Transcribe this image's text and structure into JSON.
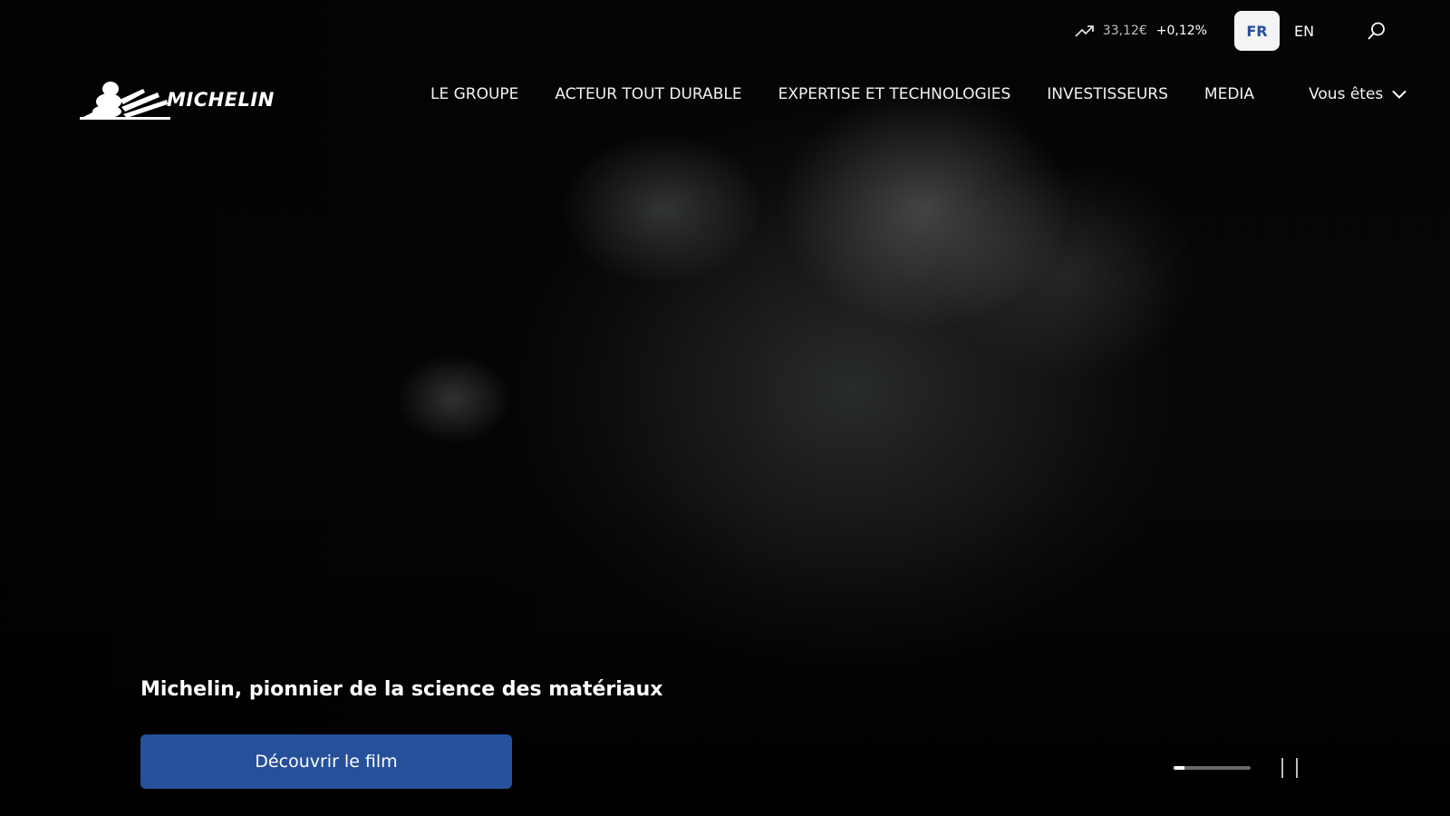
{
  "stock": {
    "price": "33,12€",
    "change": "+0,12%",
    "icon": "trend-up-icon"
  },
  "languages": [
    {
      "label": "FR",
      "active": true
    },
    {
      "label": "EN",
      "active": false
    }
  ],
  "search": {
    "icon": "search-icon"
  },
  "brand": {
    "name": "MICHELIN"
  },
  "nav": {
    "items": [
      {
        "label": "LE GROUPE"
      },
      {
        "label": "ACTEUR TOUT DURABLE"
      },
      {
        "label": "EXPERTISE ET TECHNOLOGIES"
      },
      {
        "label": "INVESTISSEURS"
      },
      {
        "label": "MEDIA"
      }
    ],
    "audience_label": "Vous êtes"
  },
  "hero": {
    "headline": "Michelin, pionnier de la science des matériaux",
    "cta_label": "Découvrir le film",
    "progress": 0.14
  },
  "colors": {
    "accent": "#27509b",
    "background": "#000000"
  }
}
